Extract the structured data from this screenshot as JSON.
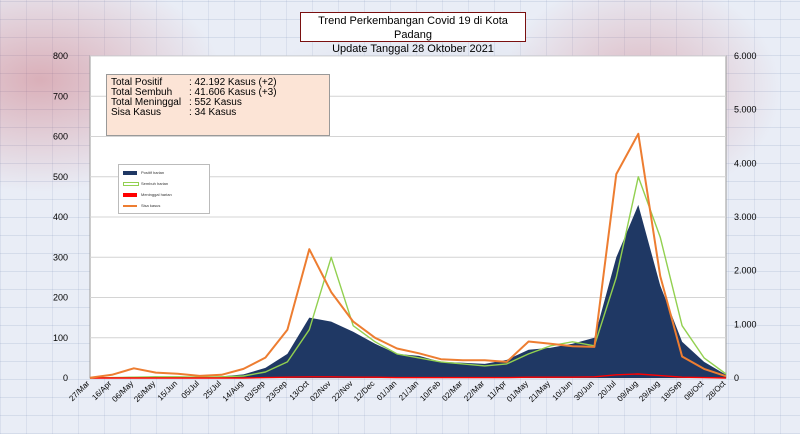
{
  "title": {
    "line1": "Trend Perkembangan Covid 19 di Kota Padang",
    "line2": "Update Tanggal 28 Oktober 2021"
  },
  "stats": [
    {
      "label": "Total Positif",
      "value": ": 42.192 Kasus (+2)"
    },
    {
      "label": "Total Sembuh",
      "value": ": 41.606 Kasus (+3)"
    },
    {
      "label": "Total Meninggal",
      "value": ":      552 Kasus"
    },
    {
      "label": "Sisa Kasus",
      "value": ":        34 Kasus"
    }
  ],
  "colors": {
    "positif": "#1f3864",
    "sembuh": "#92d050",
    "meninggal": "#ff0000",
    "sisa": "#ed7d31"
  },
  "chart_data": {
    "type": "area",
    "title": "Trend Perkembangan Covid 19 di Kota Padang",
    "subtitle": "Update Tanggal 28 Oktober 2021",
    "categories": [
      "27/Mar",
      "16/Apr",
      "06/May",
      "26/May",
      "15/Jun",
      "05/Jul",
      "25/Jul",
      "14/Aug",
      "03/Sep",
      "23/Sep",
      "13/Oct",
      "02/Nov",
      "22/Nov",
      "12/Dec",
      "01/Jan",
      "21/Jan",
      "10/Feb",
      "02/Mar",
      "22/Mar",
      "11/Apr",
      "01/May",
      "21/May",
      "10/Jun",
      "30/Jun",
      "20/Jul",
      "09/Aug",
      "29/Aug",
      "18/Sep",
      "08/Oct",
      "28/Oct"
    ],
    "y_left": {
      "ticks": [
        "0",
        "100",
        "200",
        "300",
        "400",
        "500",
        "600",
        "700",
        "800"
      ],
      "ylim": [
        0,
        800
      ]
    },
    "y_right": {
      "ticks": [
        "0",
        "1.000",
        "2.000",
        "3.000",
        "4.000",
        "5.000",
        "6.000"
      ],
      "ylim": [
        0,
        6000
      ]
    },
    "legend": {
      "placement": "left",
      "entries": [
        "Positif harian",
        "Sembuh harian",
        "Meninggal harian",
        "Sisa kasus"
      ]
    },
    "series": [
      {
        "name": "Positif harian",
        "axis": "left",
        "style": "area",
        "values": [
          1,
          2,
          3,
          4,
          2,
          3,
          4,
          9,
          25,
          60,
          150,
          140,
          115,
          85,
          60,
          55,
          40,
          38,
          35,
          45,
          70,
          75,
          85,
          100,
          300,
          430,
          230,
          90,
          40,
          8
        ]
      },
      {
        "name": "Sembuh harian",
        "axis": "left",
        "style": "line",
        "values": [
          0,
          1,
          2,
          3,
          3,
          2,
          3,
          5,
          15,
          40,
          120,
          300,
          130,
          90,
          60,
          50,
          40,
          35,
          30,
          35,
          60,
          80,
          90,
          80,
          250,
          500,
          350,
          130,
          50,
          10
        ]
      },
      {
        "name": "Meninggal harian",
        "axis": "left",
        "style": "line",
        "values": [
          0,
          0,
          0,
          0,
          0,
          0,
          0,
          0,
          1,
          2,
          3,
          3,
          2,
          2,
          1,
          1,
          1,
          1,
          1,
          1,
          2,
          2,
          2,
          3,
          8,
          10,
          6,
          2,
          1,
          0
        ]
      },
      {
        "name": "Sisa kasus",
        "axis": "right",
        "style": "line",
        "values": [
          5,
          60,
          180,
          100,
          80,
          40,
          60,
          170,
          380,
          900,
          2400,
          1600,
          1050,
          750,
          550,
          460,
          350,
          330,
          330,
          300,
          680,
          640,
          590,
          580,
          3800,
          4550,
          1900,
          400,
          170,
          34
        ]
      }
    ]
  }
}
